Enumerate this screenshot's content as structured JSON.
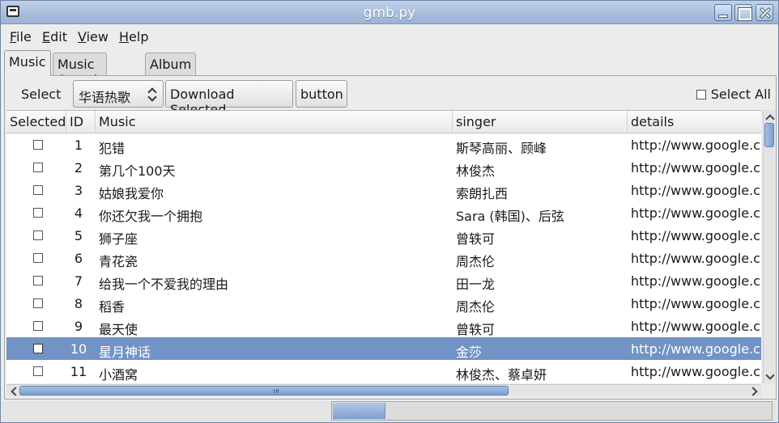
{
  "window": {
    "title": "gmb.py"
  },
  "menu": [
    {
      "key": "F",
      "rest": "ile"
    },
    {
      "key": "E",
      "rest": "dit"
    },
    {
      "key": "V",
      "rest": "iew"
    },
    {
      "key": "H",
      "rest": "elp"
    }
  ],
  "tabs": [
    {
      "label": "Music",
      "active": true
    },
    {
      "label": "Music Search",
      "active": false
    },
    {
      "label": "Album",
      "active": false
    }
  ],
  "toolbar": {
    "select_label": "Select",
    "combo_value": "华语热歌",
    "download_label": "Download Selected",
    "button_label": "button",
    "select_all_label": "Select All"
  },
  "table": {
    "headers": [
      "Selected",
      "ID",
      "Music",
      "singer",
      "details"
    ],
    "rows": [
      {
        "id": "1",
        "music": "犯错",
        "singer": "斯琴高丽、顾峰",
        "details": "http://www.google.cn"
      },
      {
        "id": "2",
        "music": "第几个100天",
        "singer": "林俊杰",
        "details": "http://www.google.cn"
      },
      {
        "id": "3",
        "music": "姑娘我爱你",
        "singer": "索朗扎西",
        "details": "http://www.google.cn"
      },
      {
        "id": "4",
        "music": "你还欠我一个拥抱",
        "singer": "Sara (韩国)、后弦",
        "details": "http://www.google.cn"
      },
      {
        "id": "5",
        "music": "狮子座",
        "singer": "曾轶可",
        "details": "http://www.google.cn"
      },
      {
        "id": "6",
        "music": "青花瓷",
        "singer": "周杰伦",
        "details": "http://www.google.cn"
      },
      {
        "id": "7",
        "music": "给我一个不爱我的理由",
        "singer": "田一龙",
        "details": "http://www.google.cn"
      },
      {
        "id": "8",
        "music": "稻香",
        "singer": "周杰伦",
        "details": "http://www.google.cn"
      },
      {
        "id": "9",
        "music": "最天使",
        "singer": "曾轶可",
        "details": "http://www.google.cn"
      },
      {
        "id": "10",
        "music": "星月神话",
        "singer": "金莎",
        "details": "http://www.google.cn"
      },
      {
        "id": "11",
        "music": "小酒窝",
        "singer": "林俊杰、蔡卓妍",
        "details": "http://www.google.cn"
      }
    ],
    "selected_row_index": 9
  },
  "colors": {
    "selection": "#7293c5",
    "titlebar": "#a9bedd"
  },
  "progress": {
    "fraction": 0.12
  }
}
